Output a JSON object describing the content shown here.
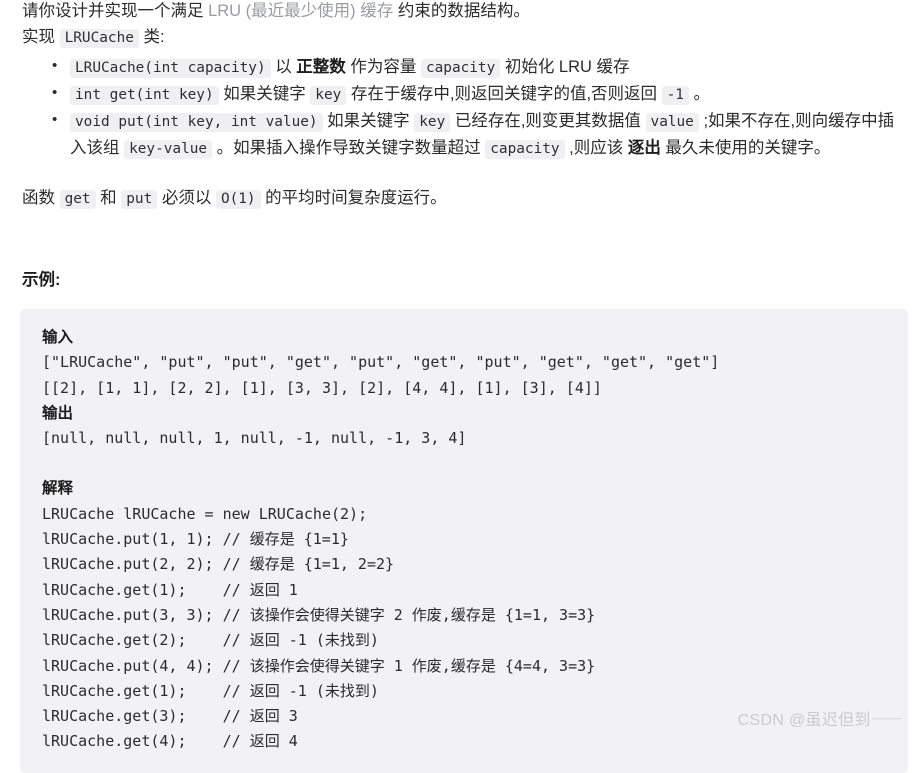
{
  "problem": {
    "intro": {
      "prefix": "请你设计并实现一个满足 ",
      "link": "LRU (最近最少使用) 缓存",
      "suffix": " 约束的数据结构。"
    },
    "implement_line": {
      "prefix": "实现 ",
      "code": "LRUCache",
      "suffix": " 类:"
    },
    "bullets": [
      {
        "code1": "LRUCache(int capacity)",
        "t1": " 以 ",
        "b1": "正整数",
        "t2": " 作为容量 ",
        "code2": "capacity",
        "t3": " 初始化 LRU 缓存"
      },
      {
        "code1": "int get(int key)",
        "t1": " 如果关键字 ",
        "code2": "key",
        "t2": " 存在于缓存中,则返回关键字的值,否则返回 ",
        "code3": "-1",
        "t3": " 。"
      },
      {
        "code1": "void put(int key, int value)",
        "t1": " 如果关键字 ",
        "code2": "key",
        "t2": " 已经存在,则变更其数据值 ",
        "code3": "value",
        "t3": " ;如果不存在,则向缓存中插入该组 ",
        "code4": "key-value",
        "t4": " 。如果插入操作导致关键字数量超过 ",
        "code5": "capacity",
        "t5": " ,则应该 ",
        "b1": "逐出",
        "t6": " 最久未使用的关键字。"
      }
    ],
    "complexity": {
      "p1": "函数 ",
      "code1": "get",
      "p2": " 和 ",
      "code2": "put",
      "p3": " 必须以 ",
      "code3": "O(1)",
      "p4": " 的平均时间复杂度运行。"
    },
    "example_heading": "示例:"
  },
  "code_block": {
    "input_label": "输入",
    "input_lines": [
      "[\"LRUCache\", \"put\", \"put\", \"get\", \"put\", \"get\", \"put\", \"get\", \"get\", \"get\"]",
      "[[2], [1, 1], [2, 2], [1], [3, 3], [2], [4, 4], [1], [3], [4]]"
    ],
    "output_label": "输出",
    "output_lines": [
      "[null, null, null, 1, null, -1, null, -1, 3, 4]"
    ],
    "explain_label": "解释",
    "explain_lines": [
      "LRUCache lRUCache = new LRUCache(2);",
      "lRUCache.put(1, 1); // 缓存是 {1=1}",
      "lRUCache.put(2, 2); // 缓存是 {1=1, 2=2}",
      "lRUCache.get(1);    // 返回 1",
      "lRUCache.put(3, 3); // 该操作会使得关键字 2 作废,缓存是 {1=1, 3=3}",
      "lRUCache.get(2);    // 返回 -1 (未找到)",
      "lRUCache.put(4, 4); // 该操作会使得关键字 1 作废,缓存是 {4=4, 3=3}",
      "lRUCache.get(1);    // 返回 -1 (未找到)",
      "lRUCache.get(3);    // 返回 3",
      "lRUCache.get(4);    // 返回 4"
    ]
  },
  "watermark": "CSDN @虽迟但到⸺"
}
